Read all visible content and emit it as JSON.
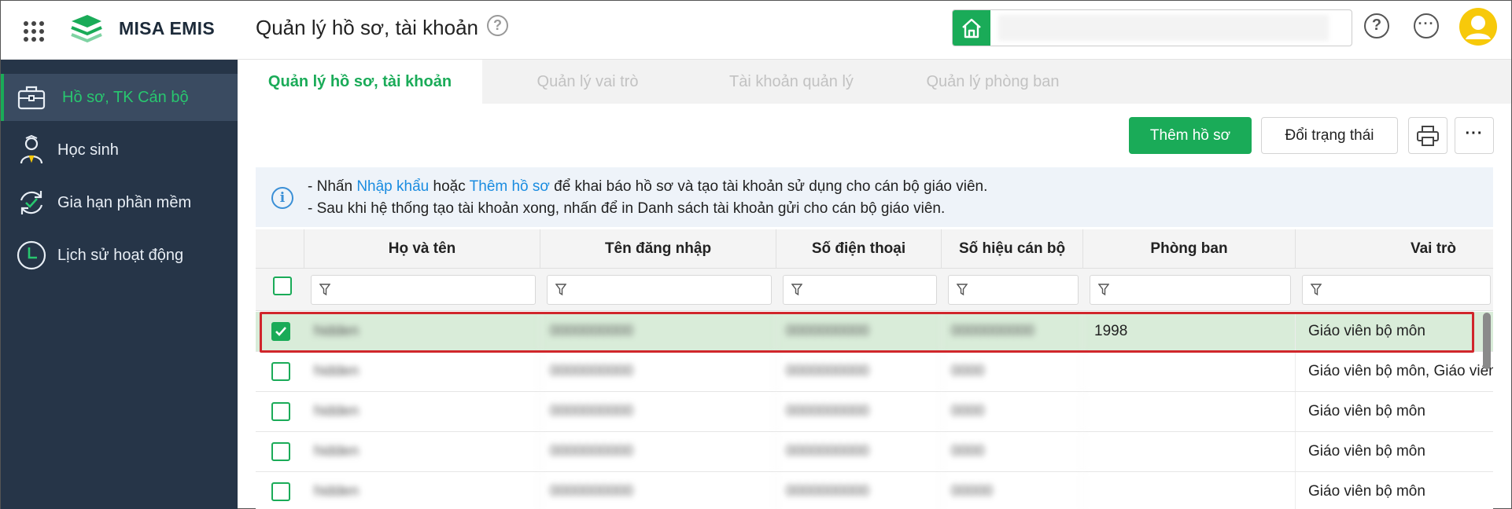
{
  "app": {
    "brand": "MISA EMIS",
    "page_title": "Quản lý hồ sơ, tài khoản",
    "title_help_icon": "?"
  },
  "header": {
    "help_icon": "?",
    "more_icon": "···"
  },
  "sidebar": {
    "items": [
      {
        "label": "Hồ sơ, TK Cán bộ",
        "icon": "briefcase-icon",
        "active": true
      },
      {
        "label": "Học sinh",
        "icon": "student-icon",
        "active": false
      },
      {
        "label": "Gia hạn phần mềm",
        "icon": "renew-icon",
        "active": false
      },
      {
        "label": "Lịch sử hoạt động",
        "icon": "clock-icon",
        "active": false
      }
    ]
  },
  "tabs": [
    {
      "label": "Quản lý hồ sơ, tài khoản",
      "active": true
    },
    {
      "label": "Quản lý vai trò",
      "active": false
    },
    {
      "label": "Tài khoản quản lý",
      "active": false
    },
    {
      "label": "Quản lý phòng ban",
      "active": false
    }
  ],
  "toolbar": {
    "add_label": "Thêm hồ sơ",
    "status_label": "Đổi trạng thái",
    "more_label": "···"
  },
  "info": {
    "line1_prefix": "- Nhấn",
    "line1_link1": "Nhập khẩu",
    "line1_mid": "hoặc",
    "line1_link2": "Thêm hồ sơ",
    "line1_suffix": "để khai báo hồ sơ và tạo tài khoản sử dụng cho cán bộ giáo viên.",
    "line2": "- Sau khi hệ thống tạo tài khoản xong, nhấn để in Danh sách tài khoản gửi cho cán bộ giáo viên."
  },
  "table": {
    "columns": [
      "Họ và tên",
      "Tên đăng nhập",
      "Số điện thoại",
      "Số hiệu cán bộ",
      "Phòng ban",
      "Vai trò"
    ],
    "rows": [
      {
        "name": "hidden",
        "username": "0000000000",
        "phone": "0000000000",
        "staff_id": "0000000000",
        "department": "1998",
        "role": "Giáo viên bộ môn",
        "checked": true
      },
      {
        "name": "hidden",
        "username": "0000000000",
        "phone": "0000000000",
        "staff_id": "0000",
        "department": "",
        "role": "Giáo viên bộ môn, Giáo viên",
        "checked": false
      },
      {
        "name": "hidden",
        "username": "0000000000",
        "phone": "0000000000",
        "staff_id": "0000",
        "department": "",
        "role": "Giáo viên bộ môn",
        "checked": false
      },
      {
        "name": "hidden",
        "username": "0000000000",
        "phone": "0000000000",
        "staff_id": "0000",
        "department": "",
        "role": "Giáo viên bộ môn",
        "checked": false
      },
      {
        "name": "hidden",
        "username": "0000000000",
        "phone": "0000000000",
        "staff_id": "00000",
        "department": "",
        "role": "Giáo viên bộ môn",
        "checked": false
      }
    ]
  },
  "colors": {
    "brand_green": "#1aab58",
    "sidebar_bg": "#263548",
    "highlight_red": "#d0262b",
    "link_blue": "#1a8ce0"
  }
}
